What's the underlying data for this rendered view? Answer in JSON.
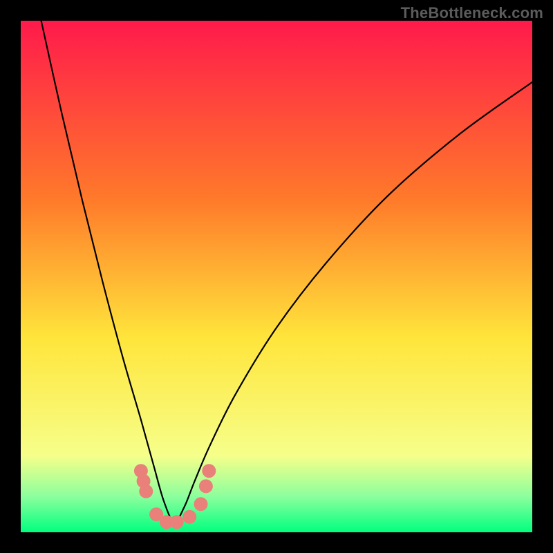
{
  "watermark": "TheBottleneck.com",
  "colors": {
    "frame_bg": "#000000",
    "watermark": "#5c5c5c",
    "gradient_top": "#ff1a4b",
    "gradient_mid1": "#ff7a2a",
    "gradient_mid2": "#ffe53b",
    "gradient_low1": "#f6ff8a",
    "gradient_low2": "#8cff9d",
    "gradient_bottom": "#00ff7f",
    "curve": "#000000",
    "dot_fill": "#e98079"
  },
  "chart_data": {
    "type": "line",
    "title": "",
    "xlabel": "",
    "ylabel": "",
    "xlim": [
      0,
      100
    ],
    "ylim": [
      0,
      100
    ],
    "notes": "Background is a vertical red→yellow→green gradient (bottleneck severity). Black V-shaped curve min near x≈30. Small salmon dots cluster along the curve near the bottom (best-match region).",
    "series": [
      {
        "name": "bottleneck-curve",
        "x": [
          4,
          8,
          12,
          16,
          20,
          23.5,
          26,
          28,
          30,
          32,
          34,
          37,
          42,
          50,
          60,
          72,
          86,
          100
        ],
        "y": [
          100,
          82,
          65,
          49,
          34,
          22,
          13,
          6,
          2,
          5,
          10,
          17,
          27,
          40,
          53,
          66,
          78,
          88
        ]
      }
    ],
    "dots": [
      {
        "x": 23.5,
        "y": 12
      },
      {
        "x": 24.0,
        "y": 10
      },
      {
        "x": 24.5,
        "y": 8
      },
      {
        "x": 26.5,
        "y": 3.5
      },
      {
        "x": 28.5,
        "y": 2
      },
      {
        "x": 30.5,
        "y": 2
      },
      {
        "x": 33.0,
        "y": 3
      },
      {
        "x": 35.2,
        "y": 5.5
      },
      {
        "x": 36.2,
        "y": 9
      },
      {
        "x": 36.8,
        "y": 12
      }
    ],
    "dot_radius_px": 10
  }
}
